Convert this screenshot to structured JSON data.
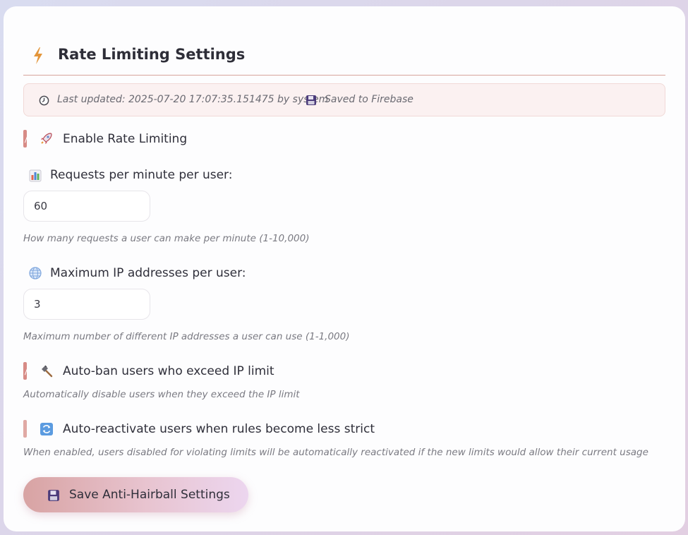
{
  "header": {
    "title": "Rate Limiting Settings",
    "icon": "lightning-icon"
  },
  "meta": {
    "last_updated": "Last updated: 2025-07-20 17:07:35.151475 by system",
    "saved": "Saved to Firebase"
  },
  "toggles": {
    "enable_rate_limiting": {
      "label": "Enable Rate Limiting",
      "checked": true,
      "icon": "rocket-icon"
    },
    "auto_ban": {
      "label": "Auto-ban users who exceed IP limit",
      "checked": true,
      "icon": "hammer-icon",
      "help": "Automatically disable users when they exceed the IP limit"
    },
    "auto_reactivate": {
      "label": "Auto-reactivate users when rules become less strict",
      "checked": false,
      "icon": "refresh-icon",
      "help": "When enabled, users disabled for violating limits will be automatically reactivated if the new limits would allow their current usage"
    }
  },
  "fields": {
    "requests_per_minute": {
      "label": "Requests per minute per user:",
      "value": "60",
      "icon": "bar-chart-icon",
      "help": "How many requests a user can make per minute (1-10,000)"
    },
    "max_ip": {
      "label": "Maximum IP addresses per user:",
      "value": "3",
      "icon": "globe-icon",
      "help": "Maximum number of different IP addresses a user can use (1-1,000)"
    }
  },
  "save_button": {
    "label": "Save Anti-Hairball Settings",
    "icon": "floppy-disk-icon"
  },
  "colors": {
    "accent": "#d78b86",
    "divider": "#d7a49c",
    "meta_bg": "#fbf1f1"
  }
}
